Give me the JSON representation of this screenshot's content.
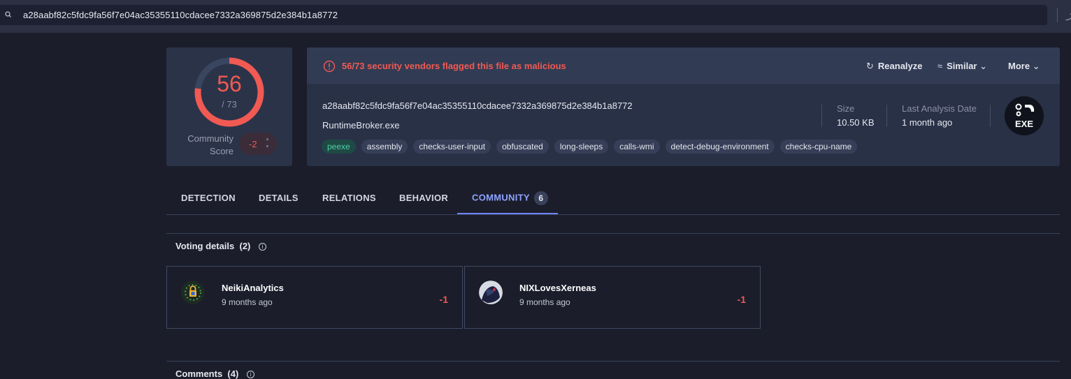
{
  "search": {
    "value": "a28aabf82c5fdc9fa56f7e04ac35355110cdacee7332a369875d2e384b1a8772"
  },
  "score": {
    "detections": "56",
    "total": "/ 73",
    "detection_fraction": 0.767,
    "community_label": "Community Score",
    "community_value": "-2",
    "color": "#f05a52"
  },
  "alert": {
    "text": "56/73 security vendors flagged this file as malicious"
  },
  "actions": {
    "reanalyze": "Reanalyze",
    "similar": "Similar",
    "more": "More"
  },
  "file": {
    "hash": "a28aabf82c5fdc9fa56f7e04ac35355110cdacee7332a369875d2e384b1a8772",
    "name": "RuntimeBroker.exe",
    "tags": [
      "peexe",
      "assembly",
      "checks-user-input",
      "obfuscated",
      "long-sleeps",
      "calls-wmi",
      "detect-debug-environment",
      "checks-cpu-name"
    ],
    "size_label": "Size",
    "size_value": "10.50 KB",
    "date_label": "Last Analysis Date",
    "date_value": "1 month ago",
    "type_badge": "EXE"
  },
  "tabs": [
    {
      "label": "DETECTION"
    },
    {
      "label": "DETAILS"
    },
    {
      "label": "RELATIONS"
    },
    {
      "label": "BEHAVIOR"
    },
    {
      "label": "COMMUNITY",
      "count": "6"
    }
  ],
  "voting": {
    "title": "Voting details",
    "count": "(2)",
    "votes": [
      {
        "user": "NeikiAnalytics",
        "time": "9 months ago",
        "score": "-1"
      },
      {
        "user": "NIXLovesXerneas",
        "time": "9 months ago",
        "score": "-1"
      }
    ]
  },
  "comments": {
    "title": "Comments",
    "count": "(4)"
  }
}
